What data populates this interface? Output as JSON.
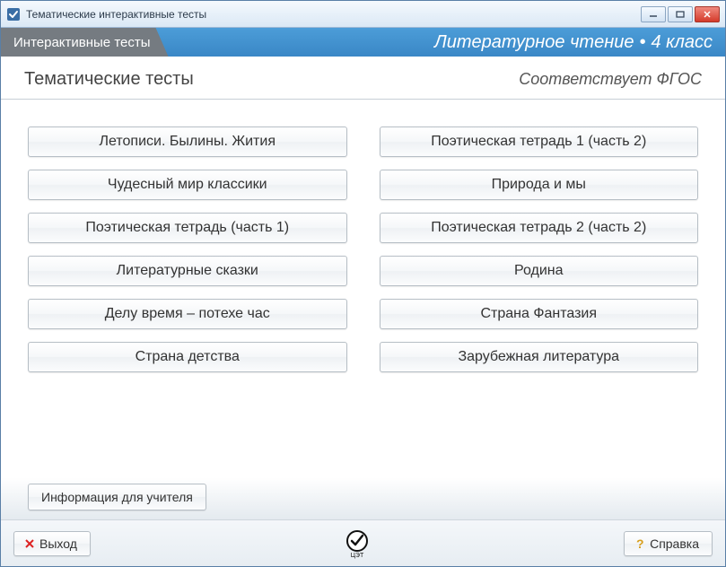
{
  "window": {
    "title": "Тематические интерактивные тесты"
  },
  "header": {
    "tab": "Интерактивные тесты",
    "subject": "Литературное чтение",
    "grade": "4 класс"
  },
  "subheader": {
    "left": "Тематические тесты",
    "right": "Соответствует ФГОС"
  },
  "topics": {
    "col1": [
      "Летописи. Былины. Жития",
      "Чудесный мир классики",
      "Поэтическая тетрадь (часть 1)",
      "Литературные сказки",
      "Делу время – потехе час",
      "Страна детства"
    ],
    "col2": [
      "Поэтическая тетрадь 1 (часть 2)",
      "Природа и мы",
      "Поэтическая тетрадь 2 (часть 2)",
      "Родина",
      "Страна Фантазия",
      "Зарубежная литература"
    ]
  },
  "teacher_info_btn": "Информация для учителя",
  "footer": {
    "exit": "Выход",
    "help": "Справка",
    "logo_label": "ЦЭТ"
  }
}
